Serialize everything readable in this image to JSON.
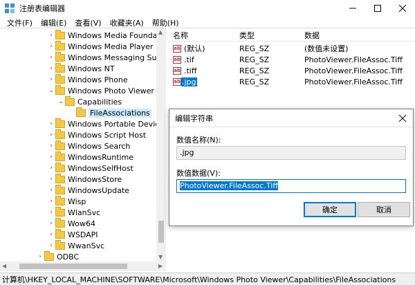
{
  "window": {
    "title": "注册表编辑器",
    "icon": "registry-editor-icon"
  },
  "menu": [
    "文件(F)",
    "编辑(E)",
    "查看(V)",
    "收藏夹(A)",
    "帮助(H)"
  ],
  "tree": {
    "items": [
      {
        "label": "Windows Media Foundation",
        "expander": "collapsed"
      },
      {
        "label": "Windows Media Player NSS",
        "expander": "collapsed"
      },
      {
        "label": "Windows Messaging Subsys",
        "expander": "collapsed"
      },
      {
        "label": "Windows NT",
        "expander": "collapsed"
      },
      {
        "label": "Windows Phone",
        "expander": "collapsed"
      },
      {
        "label": "Windows Photo Viewer",
        "expander": "expanded"
      },
      {
        "label": "Capabilities",
        "expander": "expanded"
      },
      {
        "label": "FileAssociations",
        "expander": "none",
        "selected": true
      },
      {
        "label": "Windows Portable Devices",
        "expander": "collapsed"
      },
      {
        "label": "Windows Script Host",
        "expander": "collapsed"
      },
      {
        "label": "Windows Search",
        "expander": "collapsed"
      },
      {
        "label": "WindowsRuntime",
        "expander": "collapsed"
      },
      {
        "label": "WindowsSelfHost",
        "expander": "collapsed"
      },
      {
        "label": "WindowsStore",
        "expander": "collapsed"
      },
      {
        "label": "WindowsUpdate",
        "expander": "collapsed"
      },
      {
        "label": "Wisp",
        "expander": "collapsed"
      },
      {
        "label": "WlanSvc",
        "expander": "collapsed"
      },
      {
        "label": "Wow64",
        "expander": "collapsed"
      },
      {
        "label": "WSDAPI",
        "expander": "collapsed"
      },
      {
        "label": "WwanSvc",
        "expander": "collapsed"
      },
      {
        "label": "ODBC",
        "expander": "collapsed"
      }
    ]
  },
  "list": {
    "headers": {
      "name": "名称",
      "type": "类型",
      "data": "数据"
    },
    "rows": [
      {
        "name": "(默认)",
        "type": "REG_SZ",
        "data": "(数值未设置)"
      },
      {
        "name": ".tif",
        "type": "REG_SZ",
        "data": "PhotoViewer.FileAssoc.Tiff"
      },
      {
        "name": ".tiff",
        "type": "REG_SZ",
        "data": "PhotoViewer.FileAssoc.Tiff"
      },
      {
        "name": ".jpg",
        "type": "REG_SZ",
        "data": "PhotoViewer.FileAssoc.Tiff",
        "selected": true
      }
    ],
    "value_icon": "ab"
  },
  "dialog": {
    "title": "编辑字符串",
    "name_label": "数值名称(N):",
    "name_value": ".jpg",
    "data_label": "数值数据(V):",
    "data_value": "PhotoViewer.FileAssoc.Tiff",
    "ok_label": "确定",
    "cancel_label": "取消"
  },
  "status": {
    "path": "计算机\\HKEY_LOCAL_MACHINE\\SOFTWARE\\Microsoft\\Windows Photo Viewer\\Capabilities\\FileAssociations"
  },
  "colors": {
    "accent": "#0078d7",
    "selection_light": "#cce8ff",
    "folder": "#f6c744"
  }
}
